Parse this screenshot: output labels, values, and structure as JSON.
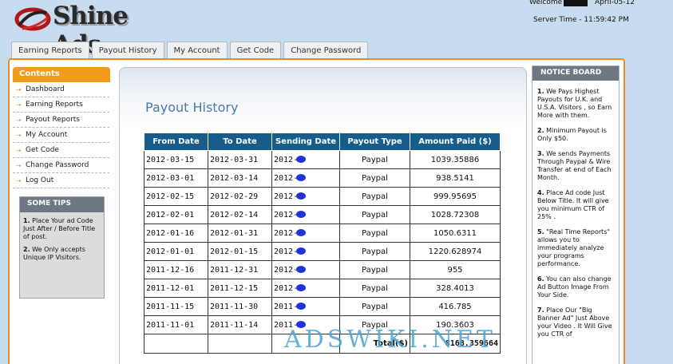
{
  "header": {
    "brand": "Shine Ads",
    "welcome_label": "Welcome",
    "date": "April-05-12",
    "server_time": "Server Time - 11:59:42 PM"
  },
  "tabs": [
    {
      "label": "Earning Reports"
    },
    {
      "label": "Payout History"
    },
    {
      "label": "My Account"
    },
    {
      "label": "Get Code"
    },
    {
      "label": "Change Password"
    }
  ],
  "sidebar": {
    "title": "Contents",
    "items": [
      {
        "label": "Dashboard"
      },
      {
        "label": "Earning Reports"
      },
      {
        "label": "Payout Reports"
      },
      {
        "label": "My Account"
      },
      {
        "label": "Get Code"
      },
      {
        "label": "Change Password"
      },
      {
        "label": "Log Out"
      }
    ]
  },
  "tips": {
    "title": "SOME TIPS",
    "items": [
      {
        "num": "1.",
        "text": "Place Your ad Code Just After / Before Title of post."
      },
      {
        "num": "2.",
        "text": "We Only accepts Unique IP Visitors."
      }
    ]
  },
  "main": {
    "title": "Payout History",
    "columns": [
      "From Date",
      "To Date",
      "Sending Date",
      "Payout Type",
      "Amount Paid ($)"
    ],
    "rows": [
      {
        "from": "2012-03-15",
        "to": "2012-03-31",
        "sending": "2012-",
        "type": "Paypal",
        "amount": "1039.35886"
      },
      {
        "from": "2012-03-01",
        "to": "2012-03-14",
        "sending": "2012-",
        "type": "Paypal",
        "amount": "938.5141"
      },
      {
        "from": "2012-02-15",
        "to": "2012-02-29",
        "sending": "2012-",
        "type": "Paypal",
        "amount": "999.95695"
      },
      {
        "from": "2012-02-01",
        "to": "2012-02-14",
        "sending": "2012-",
        "type": "Paypal",
        "amount": "1028.72308"
      },
      {
        "from": "2012-01-16",
        "to": "2012-01-31",
        "sending": "2012-",
        "type": "Paypal",
        "amount": "1050.6311"
      },
      {
        "from": "2012-01-01",
        "to": "2012-01-15",
        "sending": "2012-",
        "type": "Paypal",
        "amount": "1220.628974"
      },
      {
        "from": "2011-12-16",
        "to": "2011-12-31",
        "sending": "2012-",
        "type": "Paypal",
        "amount": "955"
      },
      {
        "from": "2011-12-01",
        "to": "2011-12-15",
        "sending": "2012-",
        "type": "Paypal",
        "amount": "328.4013"
      },
      {
        "from": "2011-11-15",
        "to": "2011-11-30",
        "sending": "2011-",
        "type": "Paypal",
        "amount": "416.785"
      },
      {
        "from": "2011-11-01",
        "to": "2011-11-14",
        "sending": "2011-",
        "type": "Paypal",
        "amount": "190.3603"
      }
    ],
    "total_label": "Total($)",
    "total_value": "8168.359664",
    "watermark": "ADSWIKI.NET"
  },
  "notice_board": {
    "title": "NOTICE BOARD",
    "items": [
      {
        "num": "1.",
        "text": "We Pays Highest Payouts for U.K. and U.S.A. Visitors , so Earn More with them."
      },
      {
        "num": "2.",
        "text": "Minimum Payout is Only $50."
      },
      {
        "num": "3.",
        "text": "We sends Payments Through Paypal & Wire Transfer at end of Each Month."
      },
      {
        "num": "4.",
        "text": "Place Ad code Just Below Title. It will give you minimum CTR of 25% ."
      },
      {
        "num": "5.",
        "text": "\"Real Time Reports\" allows you to immediately analyze your programs performance."
      },
      {
        "num": "6.",
        "text": "You can also change Ad Button Image From Your Side."
      },
      {
        "num": "7.",
        "text": "Place Our \"Big Banner Ad\" Just Above your Video . It Will Give you CTR of"
      }
    ]
  },
  "colors": {
    "background": "#c7dcef",
    "accent_orange": "#f39a1c",
    "table_header": "#175d8c",
    "title_blue": "#4a7aa5",
    "panel_gray": "#6d7883"
  },
  "icons": {
    "logo": "swirl-logo-icon",
    "menu_bullet": "orange-arrow-icon"
  }
}
